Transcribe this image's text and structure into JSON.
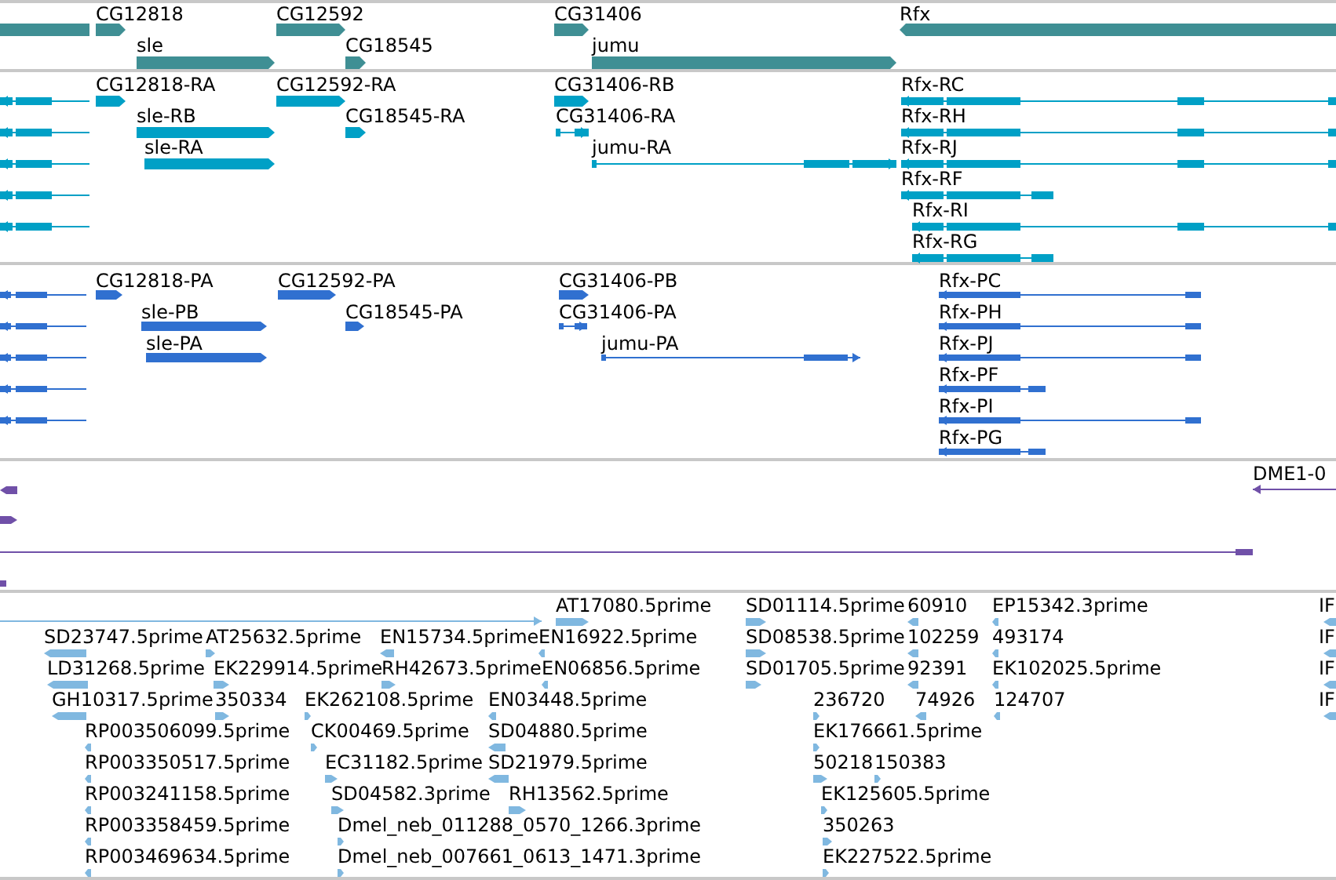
{
  "tracks": [
    {
      "color": "#3f8f94",
      "features": [
        {
          "label": "CG12818"
        },
        {
          "label": "CG12592"
        },
        {
          "label": "CG31406"
        },
        {
          "label": "Rfx"
        },
        {
          "label": "sle"
        },
        {
          "label": "CG18545"
        },
        {
          "label": "jumu"
        }
      ]
    },
    {
      "color": "#00a0c6",
      "features": [
        {
          "label": "CG12818-RA"
        },
        {
          "label": "CG12592-RA"
        },
        {
          "label": "CG31406-RB"
        },
        {
          "label": "Rfx-RC"
        },
        {
          "label": "sle-RB"
        },
        {
          "label": "CG18545-RA"
        },
        {
          "label": "CG31406-RA"
        },
        {
          "label": "Rfx-RH"
        },
        {
          "label": "sle-RA"
        },
        {
          "label": "jumu-RA"
        },
        {
          "label": "Rfx-RJ"
        },
        {
          "label": "Rfx-RF"
        },
        {
          "label": "Rfx-RI"
        },
        {
          "label": "Rfx-RG"
        }
      ]
    },
    {
      "color": "#3070d0",
      "features": [
        {
          "label": "CG12818-PA"
        },
        {
          "label": "CG12592-PA"
        },
        {
          "label": "CG31406-PB"
        },
        {
          "label": "Rfx-PC"
        },
        {
          "label": "sle-PB"
        },
        {
          "label": "CG18545-PA"
        },
        {
          "label": "CG31406-PA"
        },
        {
          "label": "Rfx-PH"
        },
        {
          "label": "sle-PA"
        },
        {
          "label": "jumu-PA"
        },
        {
          "label": "Rfx-PJ"
        },
        {
          "label": "Rfx-PF"
        },
        {
          "label": "Rfx-PI"
        },
        {
          "label": "Rfx-PG"
        }
      ]
    },
    {
      "color": "#7050a8",
      "features": [
        {
          "label": "DME1-0"
        }
      ]
    },
    {
      "color": "#80b8e0",
      "features": [
        {
          "label": "AT17080.5prime"
        },
        {
          "label": "SD01114.5prime"
        },
        {
          "label": "60910"
        },
        {
          "label": "EP15342.3prime"
        },
        {
          "label": "IF"
        },
        {
          "label": "SD23747.5prime"
        },
        {
          "label": "AT25632.5prime"
        },
        {
          "label": "EN15734.5prime"
        },
        {
          "label": "EN16922.5prime"
        },
        {
          "label": "SD08538.5prime"
        },
        {
          "label": "102259"
        },
        {
          "label": "493174"
        },
        {
          "label": "IF"
        },
        {
          "label": "LD31268.5prime"
        },
        {
          "label": "EK229914.5prime"
        },
        {
          "label": "RH42673.5prime"
        },
        {
          "label": "EN06856.5prime"
        },
        {
          "label": "SD01705.5prime"
        },
        {
          "label": "92391"
        },
        {
          "label": "EK102025.5prime"
        },
        {
          "label": "IF"
        },
        {
          "label": "GH10317.5prime"
        },
        {
          "label": "350334"
        },
        {
          "label": "EK262108.5prime"
        },
        {
          "label": "EN03448.5prime"
        },
        {
          "label": "236720"
        },
        {
          "label": "74926"
        },
        {
          "label": "124707"
        },
        {
          "label": "IF"
        },
        {
          "label": "RP003506099.5prime"
        },
        {
          "label": "CK00469.5prime"
        },
        {
          "label": "SD04880.5prime"
        },
        {
          "label": "EK176661.5prime"
        },
        {
          "label": "RP003350517.5prime"
        },
        {
          "label": "EC31182.5prime"
        },
        {
          "label": "SD21979.5prime"
        },
        {
          "label": "50218"
        },
        {
          "label": "150383"
        },
        {
          "label": "RP003241158.5prime"
        },
        {
          "label": "SD04582.3prime"
        },
        {
          "label": "RH13562.5prime"
        },
        {
          "label": "EK125605.5prime"
        },
        {
          "label": "RP003358459.5prime"
        },
        {
          "label": "Dmel_neb_011288_0570_1266.3prime"
        },
        {
          "label": "350263"
        },
        {
          "label": "RP003469634.5prime"
        },
        {
          "label": "Dmel_neb_007661_0613_1471.3prime"
        },
        {
          "label": "EK227522.5prime"
        }
      ]
    }
  ]
}
